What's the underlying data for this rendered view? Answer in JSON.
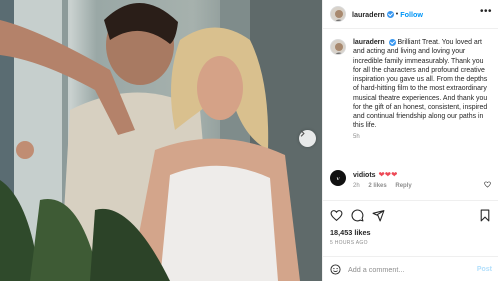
{
  "header": {
    "username": "lauradern",
    "follow_label": "Follow",
    "separator": "•",
    "more_label": "•••"
  },
  "caption": {
    "username": "lauradern",
    "text": "Brilliant Treat. You loved art and acting and living and loving your incredible family immeasurably. Thank you for all the characters and profound creative inspiration you gave us all. From the depths of hard-hitting film to the most extraordinary musical theatre experiences. And thank you for the gift of an honest, consistent, inspired and continual friendship along our paths in this life.",
    "time": "5h"
  },
  "comment": {
    "username": "vidiots",
    "hearts": "❤❤❤",
    "time": "2h",
    "likes": "2 likes",
    "reply": "Reply"
  },
  "actions": {
    "likes": "18,453 likes",
    "time_ago": "5 HOURS AGO"
  },
  "add_comment": {
    "placeholder": "Add a comment...",
    "post_label": "Post"
  },
  "colors": {
    "link_blue": "#0095f6",
    "verified_blue": "#3897f0",
    "heart_red": "#ed4956",
    "muted": "#8e8e8e"
  },
  "icons": [
    "verified-badge-icon",
    "more-options-icon",
    "chevron-right-icon",
    "heart-icon",
    "comment-icon",
    "share-icon",
    "bookmark-icon",
    "emoji-icon"
  ]
}
